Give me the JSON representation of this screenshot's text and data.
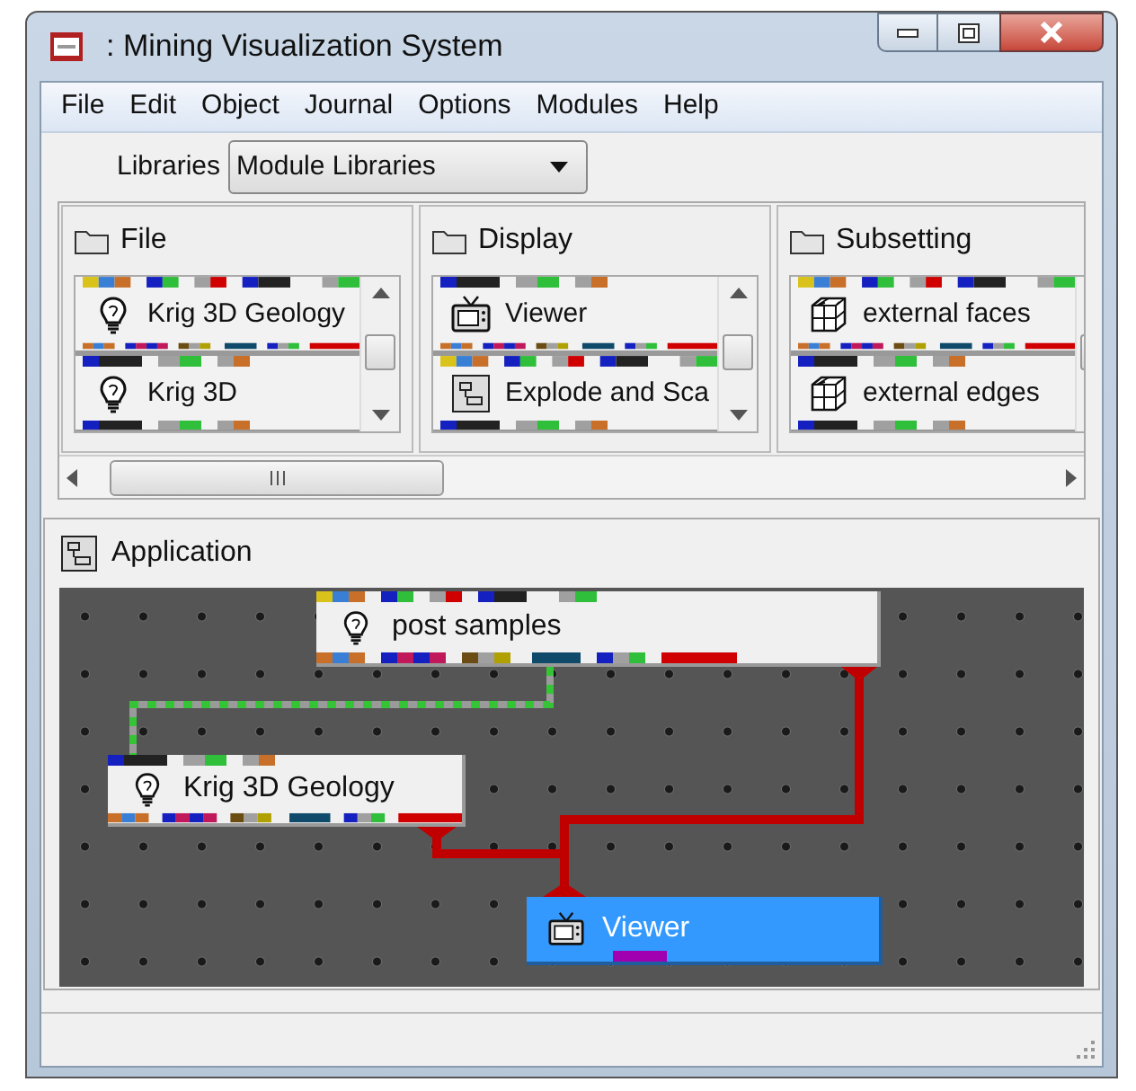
{
  "window": {
    "title": ": Mining Visualization System"
  },
  "menu": [
    "File",
    "Edit",
    "Object",
    "Journal",
    "Options",
    "Modules",
    "Help"
  ],
  "libraries": {
    "label": "Libraries",
    "value": "Module Libraries"
  },
  "library_panels": [
    {
      "title": "File",
      "modules": [
        {
          "label": "Krig 3D Geology",
          "kind": "bulb"
        },
        {
          "label": "Krig 3D",
          "kind": "bulb"
        }
      ]
    },
    {
      "title": "Display",
      "modules": [
        {
          "label": "Viewer",
          "kind": "tv"
        },
        {
          "label": "Explode and Sca",
          "kind": "diagram"
        }
      ]
    },
    {
      "title": "Subsetting",
      "modules": [
        {
          "label": "external faces",
          "kind": "cube"
        },
        {
          "label": "external edges",
          "kind": "cube"
        }
      ]
    }
  ],
  "application": {
    "title": "Application",
    "nodes": [
      {
        "label": "post samples",
        "kind": "bulb",
        "selected": false
      },
      {
        "label": "Krig 3D Geology",
        "kind": "bulb",
        "selected": false
      },
      {
        "label": "Viewer",
        "kind": "tv",
        "selected": true
      }
    ]
  }
}
